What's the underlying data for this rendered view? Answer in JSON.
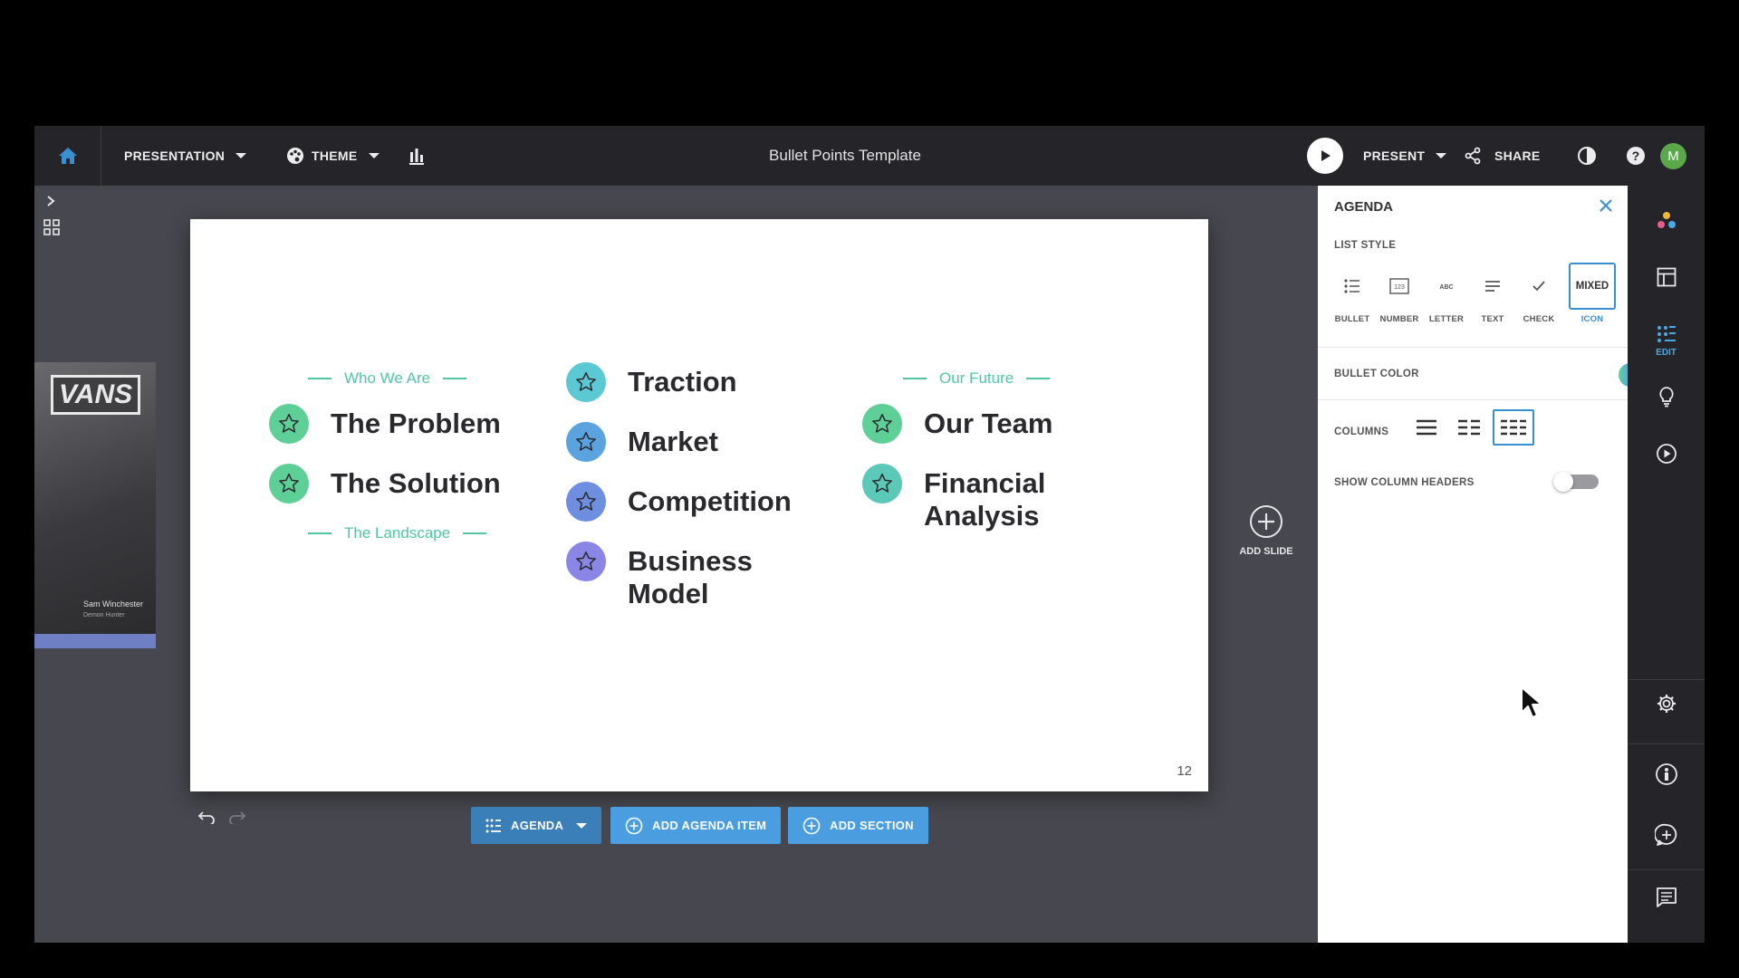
{
  "topbar": {
    "presentation_label": "PRESENTATION",
    "theme_label": "THEME",
    "doc_title": "Bullet Points Template",
    "present_label": "PRESENT",
    "share_label": "SHARE",
    "avatar_initial": "M"
  },
  "thumbnail": {
    "brand": "VANS",
    "name": "Sam Winchester",
    "role": "Demon Hunter"
  },
  "slide": {
    "page_number": "12",
    "col1_header": "Who We Are",
    "col1_items": [
      "The Problem",
      "The Solution"
    ],
    "col1_footer": "The Landscape",
    "col2_items": [
      "Traction",
      "Market",
      "Competition",
      "Business Model"
    ],
    "col3_header": "Our Future",
    "col3_items": [
      "Our Team",
      "Financial Analysis"
    ]
  },
  "add_slide_label": "ADD SLIDE",
  "bottom_toolbar": {
    "agenda_label": "AGENDA",
    "add_item_label": "ADD AGENDA ITEM",
    "add_section_label": "ADD SECTION"
  },
  "panel": {
    "title": "AGENDA",
    "list_style_label": "LIST STYLE",
    "styles": [
      {
        "label": "BULLET",
        "icon": "bullet-list-icon"
      },
      {
        "label": "NUMBER",
        "icon": "number-list-icon"
      },
      {
        "label": "LETTER",
        "icon": "letter-list-icon"
      },
      {
        "label": "TEXT",
        "icon": "text-list-icon"
      },
      {
        "label": "CHECK",
        "icon": "check-icon"
      },
      {
        "label": "ICON",
        "box_text": "MIXED"
      }
    ],
    "selected_style": "ICON",
    "bullet_color_label": "BULLET COLOR",
    "columns_label": "COLUMNS",
    "selected_columns": 3,
    "show_headers_label": "SHOW COLUMN HEADERS",
    "show_headers": false
  },
  "rail": {
    "edit_label": "EDIT"
  },
  "colors": {
    "accent": "#3a8fd0",
    "button_blue": "#4a9ee0",
    "star_green": "#5fcf98",
    "star_teal": "#5cc8d4",
    "star_blue": "#5aa3df",
    "star_indigo": "#6e8fe0",
    "star_purple": "#8a86e6",
    "section_text": "#52c6a2"
  }
}
